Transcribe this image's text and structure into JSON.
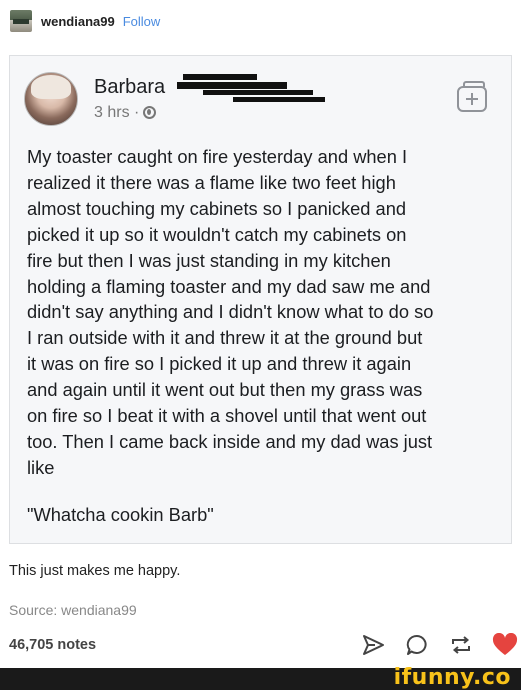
{
  "header": {
    "username": "wendiana99",
    "follow_label": "Follow"
  },
  "fb_post": {
    "author_first_name": "Barbara",
    "timestamp": "3 hrs ·",
    "lines": [
      "My toaster caught on fire yesterday and when I",
      "realized it there was a flame like two feet high",
      "almost touching my cabinets so I panicked and",
      "picked it up so it wouldn't catch my cabinets on",
      "fire but then I was just standing in my kitchen",
      "holding a flaming toaster and my dad saw me and",
      "didn't say anything and I didn't know what to do so",
      "I ran outside with it and threw it at the ground but",
      "it was on fire so I picked it up and threw it again",
      "and again until it went out but then my grass was",
      "on fire so I beat it with a shovel until that went out",
      "too. Then I came back inside and my dad was just",
      "like"
    ],
    "quote": "\"Whatcha cookin Barb\""
  },
  "caption": "This just makes me happy.",
  "source": {
    "label": "Source:",
    "user": "wendiana99"
  },
  "notes": "46,705 notes",
  "actions": [
    "send-icon",
    "reply-icon",
    "reblog-icon",
    "like-icon"
  ],
  "watermark": "ifunny.co",
  "colors": {
    "follow": "#4a8be0",
    "like": "#e5443f",
    "watermark": "#f8c21a"
  }
}
